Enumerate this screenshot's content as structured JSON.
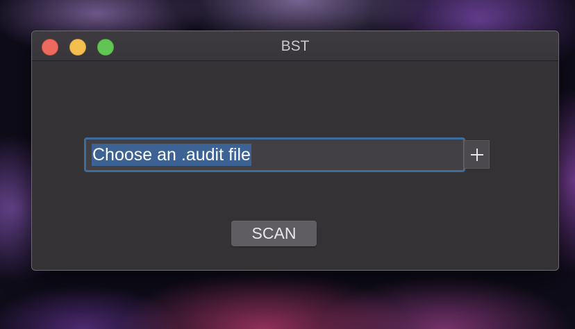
{
  "window": {
    "title": "BST"
  },
  "file_picker": {
    "value": "Choose an .audit file",
    "add_icon": "plus-icon"
  },
  "actions": {
    "scan_label": "SCAN"
  },
  "colors": {
    "window_bg": "#353236",
    "focus_ring": "#3c6d9c",
    "selection": "#3d6294",
    "close": "#ed6a5e",
    "minimize": "#f4bf4f",
    "zoom": "#61c554"
  }
}
